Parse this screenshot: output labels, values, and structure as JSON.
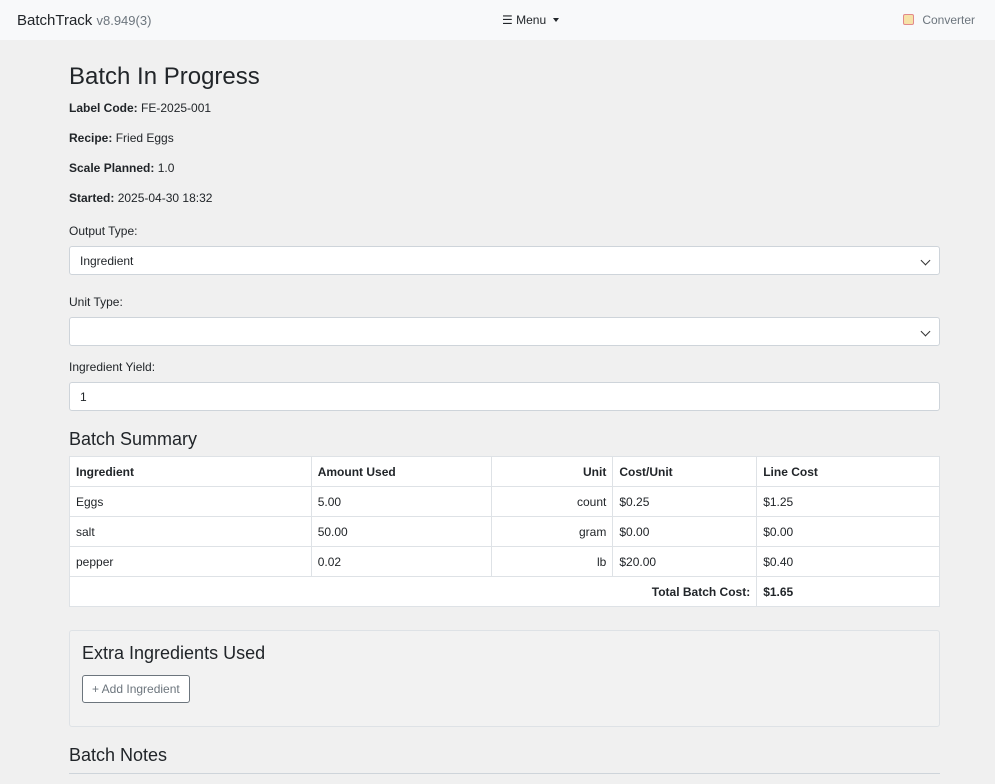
{
  "navbar": {
    "brand": "BatchTrack",
    "version": "v8.949(3)",
    "menu_label": "Menu",
    "converter_label": "Converter"
  },
  "page": {
    "title": "Batch In Progress",
    "label_code_label": "Label Code:",
    "label_code": "FE-2025-001",
    "recipe_label": "Recipe:",
    "recipe": "Fried Eggs",
    "scale_label": "Scale Planned:",
    "scale": "1.0",
    "started_label": "Started:",
    "started": "2025-04-30 18:32"
  },
  "form": {
    "output_type_label": "Output Type:",
    "output_type_value": "Ingredient",
    "unit_type_label": "Unit Type:",
    "unit_type_value": "",
    "yield_label": "Ingredient Yield:",
    "yield_value": "1"
  },
  "summary": {
    "heading": "Batch Summary",
    "columns": [
      "Ingredient",
      "Amount Used",
      "Unit",
      "Cost/Unit",
      "Line Cost"
    ],
    "rows": [
      {
        "ingredient": "Eggs",
        "amount": "5.00",
        "unit": "count",
        "cost_unit": "$0.25",
        "line_cost": "$1.25"
      },
      {
        "ingredient": "salt",
        "amount": "50.00",
        "unit": "gram",
        "cost_unit": "$0.00",
        "line_cost": "$0.00"
      },
      {
        "ingredient": "pepper",
        "amount": "0.02",
        "unit": "lb",
        "cost_unit": "$20.00",
        "line_cost": "$0.40"
      }
    ],
    "total_label": "Total Batch Cost:",
    "total_value": "$1.65"
  },
  "extra": {
    "heading": "Extra Ingredients Used",
    "add_button": "+ Add Ingredient"
  },
  "notes": {
    "heading": "Batch Notes"
  }
}
